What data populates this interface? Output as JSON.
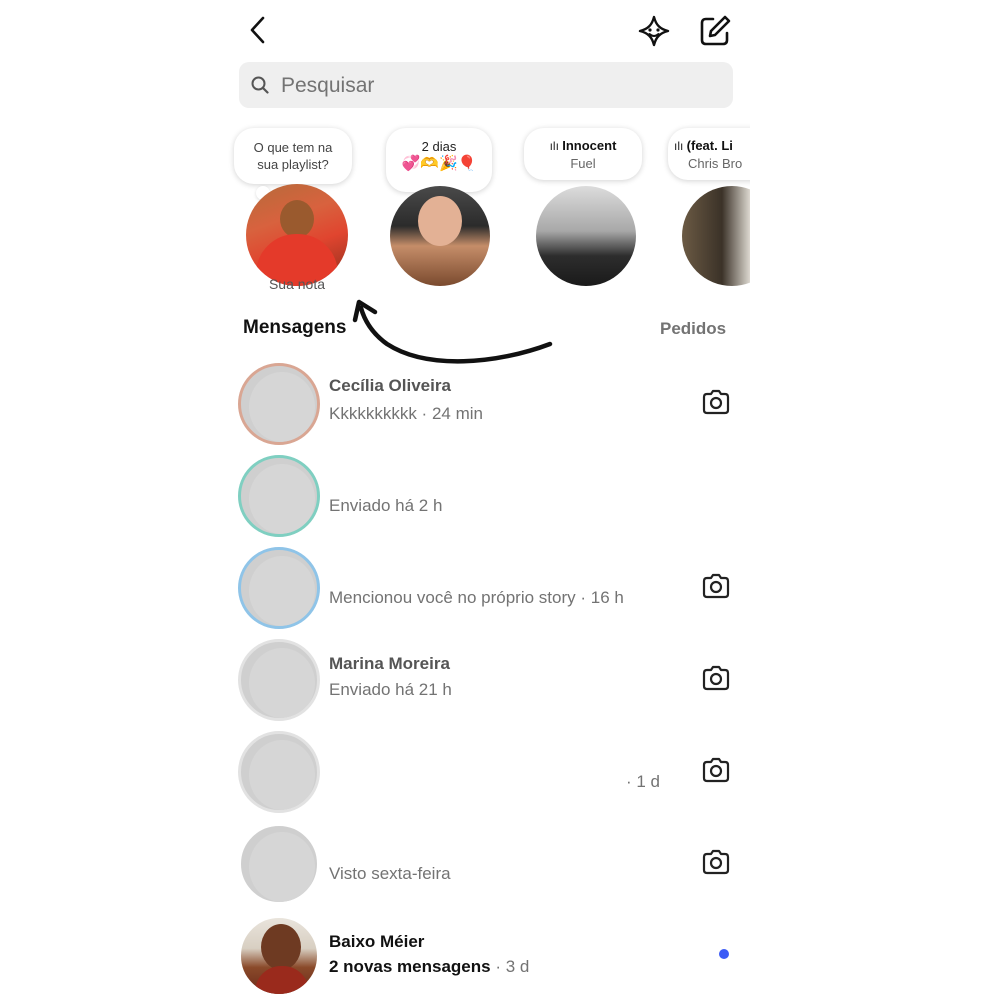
{
  "header": {
    "back_icon": "chevron-left-icon",
    "ai_icon": "meta-ai-icon",
    "compose_icon": "compose-icon"
  },
  "search": {
    "placeholder": "Pesquisar"
  },
  "notes": [
    {
      "note": "O que tem na sua playlist?",
      "label": "Sua nota"
    },
    {
      "note_line1": "2 dias",
      "note_line2": "💞🫶🎉🎈"
    },
    {
      "music_title": "Innocent",
      "music_artist": "Fuel"
    },
    {
      "music_title": "(feat. Li",
      "music_artist": "Chris Bro"
    }
  ],
  "section": {
    "title": "Mensagens",
    "requests": "Pedidos"
  },
  "conversations": [
    {
      "name": "Cecília Oliveira",
      "preview": "Kkkkkkkkkk · 24 min",
      "camera": true
    },
    {
      "preview": "Enviado há 2 h",
      "camera": false
    },
    {
      "preview": "Mencionou você no próprio story · 16 h",
      "camera": true
    },
    {
      "name": "Marina Moreira",
      "preview": "Enviado há 21 h",
      "camera": true
    },
    {
      "time": "· 1 d",
      "camera": true
    },
    {
      "preview": "Visto sexta-feira",
      "camera": true
    },
    {
      "name": "Baixo Méier",
      "preview": "2 novas mensagens",
      "time": "· 3 d",
      "unread": true
    }
  ],
  "colors": {
    "unread_dot": "#3b5bf6",
    "muted_text": "#737373",
    "search_bg": "#efefef"
  }
}
